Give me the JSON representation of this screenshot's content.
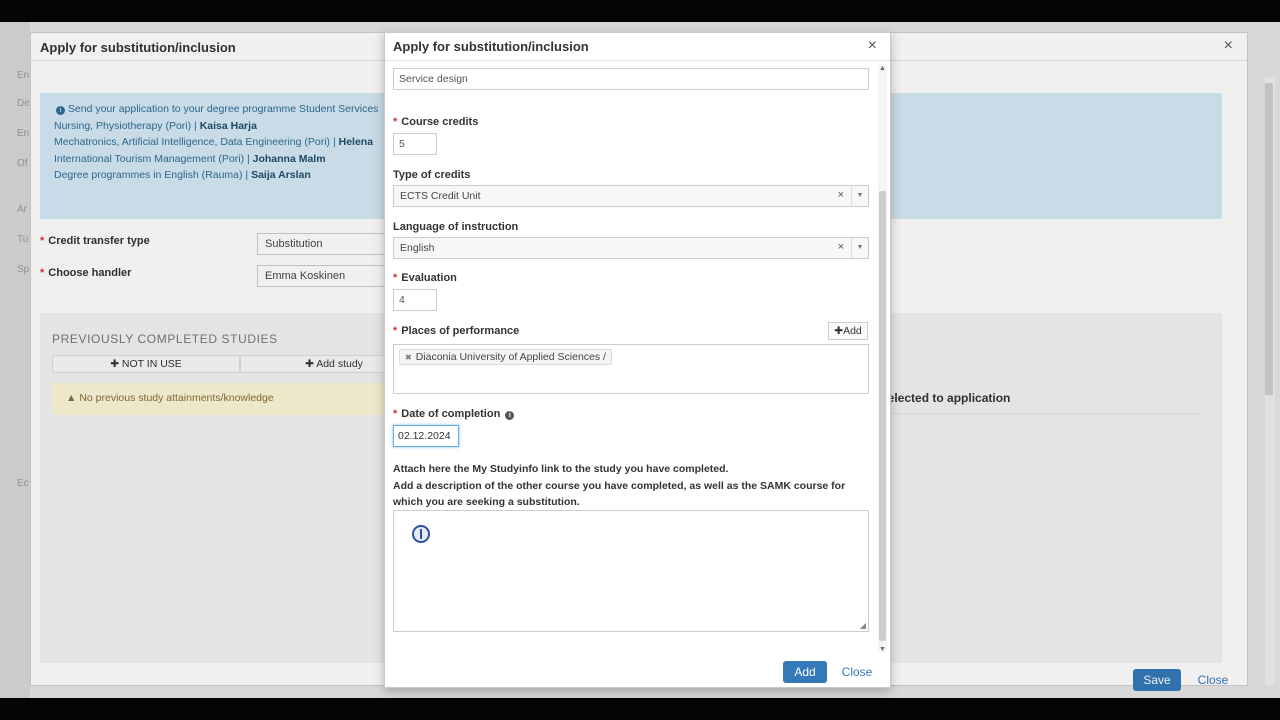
{
  "background": {
    "title": "Apply for substitution/inclusion",
    "info_lines": [
      {
        "text": "Send your application to your degree programme Student Services",
        "bold": ""
      },
      {
        "text": "Nursing, Physiotherapy (Pori) | ",
        "bold": "Kaisa Harja"
      },
      {
        "text": "Mechatronics, Artificial Intelligence, Data Engineering (Pori) | ",
        "bold": "Helena"
      },
      {
        "text": "International Tourism Management (Pori) | ",
        "bold": "Johanna Malm"
      },
      {
        "text": "Degree programmes in English (Rauma) | ",
        "bold": "Saija Arslan"
      }
    ],
    "credit_transfer_type_label": "Credit transfer type",
    "credit_transfer_type_value": "Substitution",
    "choose_handler_label": "Choose handler",
    "choose_handler_value": "Emma Koskinen",
    "previous_title": "PREVIOUSLY COMPLETED STUDIES",
    "not_in_use_label": "NOT IN USE",
    "add_study_label": "Add study",
    "no_previous": "No previous study attainments/knowledge",
    "selected_label": "selected to application",
    "save_label": "Save",
    "close_label": "Close"
  },
  "modal": {
    "title": "Apply for substitution/inclusion",
    "course_name_value": "Service design",
    "course_credits_label": "Course credits",
    "course_credits_value": "5",
    "type_of_credits_label": "Type of credits",
    "type_of_credits_value": "ECTS Credit Unit",
    "language_label": "Language of instruction",
    "language_value": "English",
    "evaluation_label": "Evaluation",
    "evaluation_value": "4",
    "places_label": "Places of performance",
    "places_add_label": "Add",
    "places_tag": "Diaconia University of Applied Sciences /",
    "date_label": "Date of completion",
    "date_value": "02.12.2024",
    "attach_text_1": "Attach here the My Studyinfo link to the study you have completed.",
    "attach_text_2": "Add a description of the other course you have completed, as well as the SAMK course for which you are seeking a substitution.",
    "add_button": "Add",
    "close_button": "Close"
  },
  "colors": {
    "primary": "#3579b8",
    "info_bg": "#d6e9f6",
    "warning_bg": "#fbf7d6",
    "required": "#cc3333"
  }
}
